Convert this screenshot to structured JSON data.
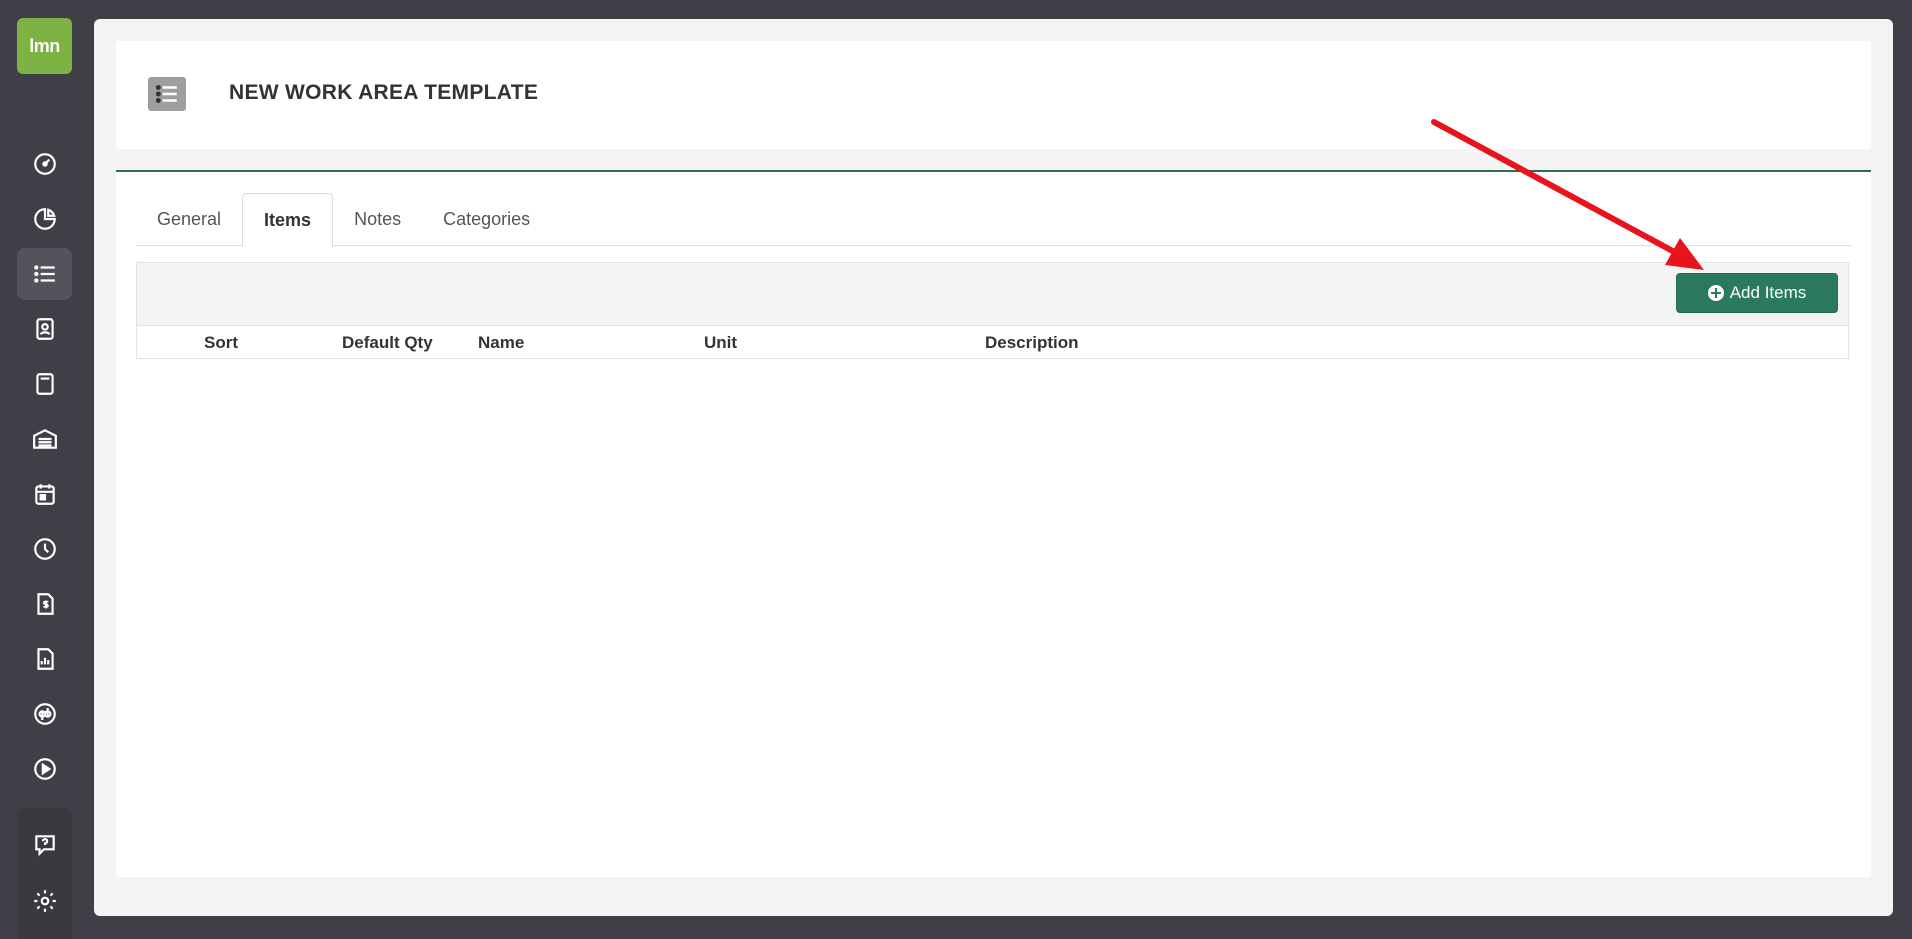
{
  "app": {
    "logo_text": "lmn"
  },
  "sidebar": {
    "items": [
      {
        "icon": "dashboard-icon"
      },
      {
        "icon": "pie-chart-icon"
      },
      {
        "icon": "list-icon",
        "active": true
      },
      {
        "icon": "contact-card-icon"
      },
      {
        "icon": "calculator-icon"
      },
      {
        "icon": "warehouse-icon"
      },
      {
        "icon": "calendar-icon"
      },
      {
        "icon": "clock-icon"
      },
      {
        "icon": "invoice-icon"
      },
      {
        "icon": "report-icon"
      },
      {
        "icon": "quickbooks-icon"
      },
      {
        "icon": "play-icon"
      }
    ],
    "bottom": [
      {
        "icon": "help-icon"
      },
      {
        "icon": "gear-icon"
      }
    ]
  },
  "header": {
    "title": "NEW WORK AREA TEMPLATE"
  },
  "tabs": [
    {
      "label": "General"
    },
    {
      "label": "Items",
      "active": true
    },
    {
      "label": "Notes"
    },
    {
      "label": "Categories"
    }
  ],
  "toolbar": {
    "add_label": "Add Items"
  },
  "table": {
    "columns": [
      "Sort",
      "Default Qty",
      "Name",
      "Unit",
      "Description"
    ],
    "rows": []
  },
  "colors": {
    "accent": "#2b7a5d",
    "logo": "#7cb342",
    "annotation_arrow": "#e8141b"
  }
}
